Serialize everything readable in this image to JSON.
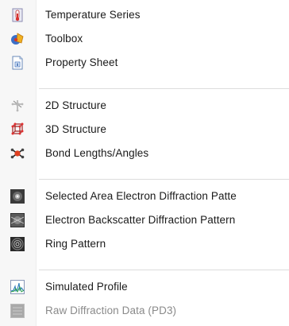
{
  "menu": {
    "items": [
      {
        "label": "Temperature Series",
        "icon": "thermometer-icon",
        "enabled": true
      },
      {
        "label": "Toolbox",
        "icon": "toolbox-icon",
        "enabled": true
      },
      {
        "label": "Property Sheet",
        "icon": "property-sheet-icon",
        "enabled": true
      },
      {
        "label": "2D Structure",
        "icon": "2d-structure-icon",
        "enabled": false
      },
      {
        "label": "3D Structure",
        "icon": "3d-structure-icon",
        "enabled": true
      },
      {
        "label": "Bond Lengths/Angles",
        "icon": "bond-lengths-icon",
        "enabled": true
      },
      {
        "label": "Selected Area Electron Diffraction Patte",
        "icon": "saed-pattern-icon",
        "enabled": true
      },
      {
        "label": "Electron Backscatter Diffraction Pattern",
        "icon": "ebsd-pattern-icon",
        "enabled": true
      },
      {
        "label": "Ring Pattern",
        "icon": "ring-pattern-icon",
        "enabled": true
      },
      {
        "label": "Simulated Profile",
        "icon": "simulated-profile-icon",
        "enabled": true
      },
      {
        "label": "Raw Diffraction Data (PD3)",
        "icon": "raw-diffraction-data-icon",
        "enabled": false
      }
    ]
  },
  "colors": {
    "text": "#1a1a1a",
    "disabled_text": "#8a8a8a",
    "separator": "#dcdcdc",
    "gutter": "#f7f7f7"
  }
}
